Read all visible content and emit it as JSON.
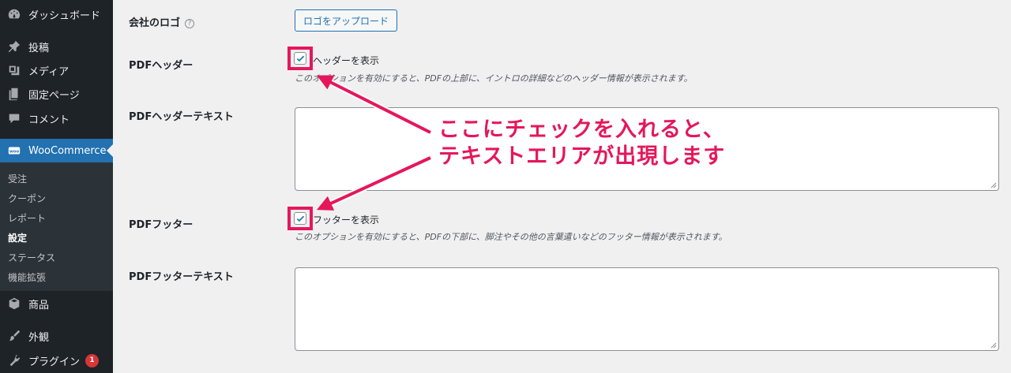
{
  "sidebar": {
    "items": [
      {
        "label": "ダッシュボード",
        "icon": "dashboard-icon"
      },
      {
        "label": "投稿",
        "icon": "pin-icon"
      },
      {
        "label": "メディア",
        "icon": "media-icon"
      },
      {
        "label": "固定ページ",
        "icon": "page-icon"
      },
      {
        "label": "コメント",
        "icon": "comment-icon"
      },
      {
        "label": "WooCommerce",
        "icon": "woocommerce-icon"
      },
      {
        "label": "商品",
        "icon": "box-icon"
      },
      {
        "label": "外観",
        "icon": "brush-icon"
      },
      {
        "label": "プラグイン",
        "icon": "plugin-icon",
        "badge": "1"
      }
    ],
    "submenu": [
      "受注",
      "クーポン",
      "レポート",
      "設定",
      "ステータス",
      "機能拡張"
    ],
    "current_submenu": "設定"
  },
  "settings": {
    "logo": {
      "label": "会社のロゴ",
      "help": "?",
      "button": "ロゴをアップロード"
    },
    "header": {
      "label": "PDFヘッダー",
      "checkbox_label": "ヘッダーを表示",
      "checked": true,
      "description": "このオプションを有効にすると、PDFの上部に、イントロの詳細などのヘッダー情報が表示されます。"
    },
    "header_text": {
      "label": "PDFヘッダーテキスト",
      "value": ""
    },
    "footer": {
      "label": "PDFフッター",
      "checkbox_label": "フッターを表示",
      "checked": true,
      "description": "このオプションを有効にすると、PDFの下部に、脚注やその他の言葉遣いなどのフッター情報が表示されます。"
    },
    "footer_text": {
      "label": "PDFフッターテキスト",
      "value": ""
    }
  },
  "annotation": {
    "line1": "ここにチェックを入れると、",
    "line2": "テキストエリアが出現します",
    "color": "#e5175b"
  },
  "colors": {
    "sidebar_bg": "#1d2327",
    "active": "#2271b1",
    "accent": "#e5175b"
  }
}
